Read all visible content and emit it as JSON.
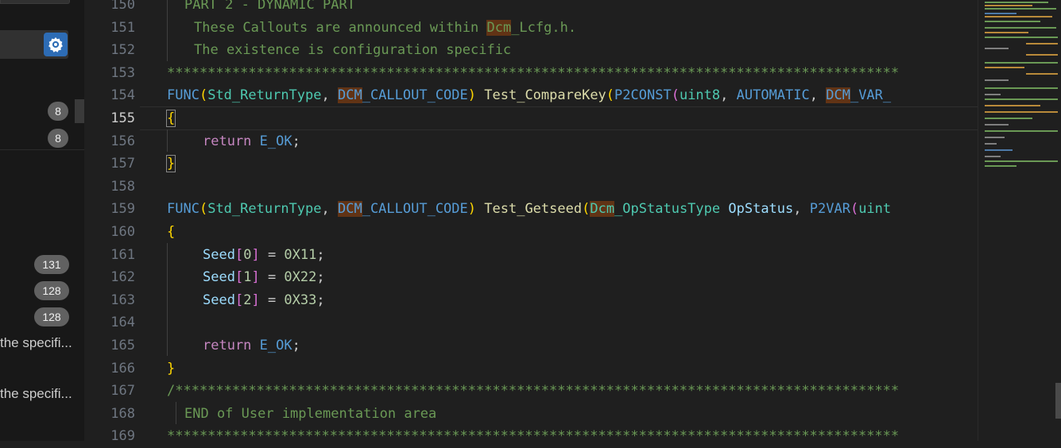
{
  "sidebar": {
    "badges_top": [
      "8",
      "8"
    ],
    "badges_mid": [
      "131",
      "128",
      "128"
    ],
    "truncated_items": [
      "the specifi...",
      "the specifi..."
    ],
    "settings_icon": "gear-settings-icon"
  },
  "editor": {
    "line_numbers": [
      "150",
      "151",
      "152",
      "153",
      "154",
      "155",
      "156",
      "157",
      "158",
      "159",
      "160",
      "161",
      "162",
      "163",
      "164",
      "165",
      "166",
      "167",
      "168",
      "169"
    ],
    "active_line": "155",
    "stars": "********************************************************"
  },
  "code": {
    "l150": "PART 2 - DYNAMIC PART",
    "l151_a": "These Callouts are announced within ",
    "l151_b": "Dcm",
    "l151_c": "_Lcfg.h.",
    "l152": "The existence is configuration specific",
    "l153": "******************************************************************************************",
    "func": "FUNC",
    "ret_type": "Std_ReturnType",
    "dcm": "DCM",
    "callout_code": "_CALLOUT_CODE",
    "fn1": "Test_CompareKey",
    "p2const": "P2CONST",
    "uint8": "uint8",
    "automatic": "AUTOMATIC",
    "dcm_var": "_VAR_",
    "return": "return",
    "e_ok": "E_OK",
    "fn2": "Test_Getseed",
    "dcm_type_a": "Dcm",
    "dcm_type_b": "_OpStatusType",
    "opstatus": "OpStatus",
    "p2var": "P2VAR",
    "uint_trunc": "uint",
    "seed": "Seed",
    "idx0": "0",
    "idx1": "1",
    "idx2": "2",
    "val0": "0X11",
    "val1": "0X22",
    "val2": "0X33",
    "l167": "/*****************************************************************************************",
    "l168": "END of User implementation area",
    "l169": "******************************************************************************************"
  }
}
